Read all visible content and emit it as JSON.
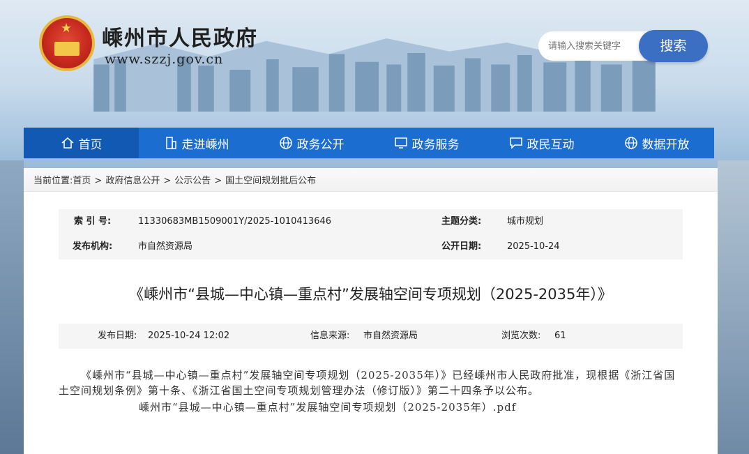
{
  "header": {
    "site_title": "嵊州市人民政府",
    "site_url": "www.szzj.gov.cn",
    "search_placeholder": "请输入搜索关键字",
    "search_button": "搜索"
  },
  "nav": {
    "items": [
      {
        "label": "首页",
        "icon": "home-icon"
      },
      {
        "label": "走进嵊州",
        "icon": "building-icon"
      },
      {
        "label": "政务公开",
        "icon": "globe-icon"
      },
      {
        "label": "政务服务",
        "icon": "monitor-icon"
      },
      {
        "label": "政民互动",
        "icon": "chat-icon"
      },
      {
        "label": "数据开放",
        "icon": "globe-icon"
      }
    ]
  },
  "breadcrumb": {
    "prefix": "当前位置:",
    "items": [
      "首页",
      "政府信息公开",
      "公示公告",
      "国土空间规划批后公布"
    ],
    "separator": ">"
  },
  "meta": {
    "index_label": "索 引 号:",
    "index_value": "11330683MB1509001Y/2025-1010413646",
    "topic_label": "主题分类:",
    "topic_value": "城市规划",
    "org_label": "发布机构:",
    "org_value": "市自然资源局",
    "open_date_label": "公开日期:",
    "open_date_value": "2025-10-24"
  },
  "document": {
    "title": "《嵊州市“县城—中心镇—重点村”发展轴空间专项规划（2025-2035年）》",
    "publish_label": "发布日期:",
    "publish_value": "2025-10-24 12:02",
    "source_label": "信息来源:",
    "source_value": "市自然资源局",
    "views_label": "浏览次数:",
    "views_value": "61",
    "body": "《嵊州市“县城—中心镇—重点村”发展轴空间专项规划（2025-2035年）》已经嵊州市人民政府批准，现根据《浙江省国土空间规划条例》第十条、《浙江省国土空间专项规划管理办法（修订版）》第二十四条予以公布。",
    "attachment": "嵊州市“县城—中心镇—重点村”发展轴空间专项规划（2025-2035年）.pdf"
  }
}
